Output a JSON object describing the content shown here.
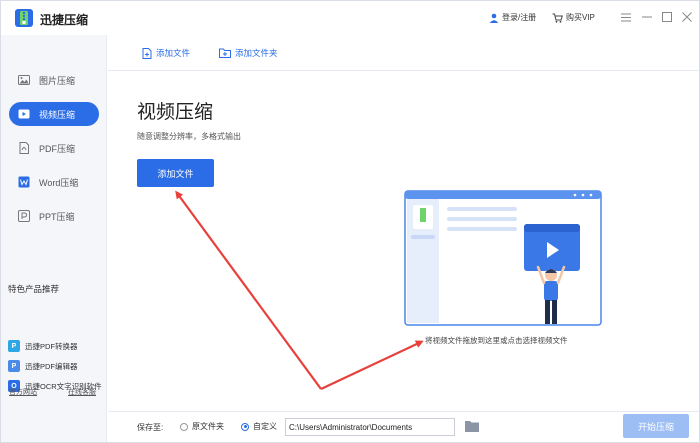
{
  "app": {
    "title": "迅捷压缩"
  },
  "header": {
    "login_label": "登录/注册",
    "vip_label": "购买VIP"
  },
  "sidebar": {
    "items": [
      {
        "label": "图片压缩",
        "icon": "image-icon"
      },
      {
        "label": "视频压缩",
        "icon": "video-icon",
        "active": true
      },
      {
        "label": "PDF压缩",
        "icon": "pdf-icon"
      },
      {
        "label": "Word压缩",
        "icon": "word-icon"
      },
      {
        "label": "PPT压缩",
        "icon": "ppt-icon"
      }
    ],
    "promo_title": "特色产品推荐",
    "promo_items": [
      {
        "label": "迅捷PDF转换器",
        "icon": "pdf-converter-icon"
      },
      {
        "label": "迅捷PDF编辑器",
        "icon": "pdf-editor-icon"
      },
      {
        "label": "迅捷OCR文字识别软件",
        "icon": "ocr-icon"
      }
    ],
    "footer_links": [
      "官方网站",
      "在线客服"
    ]
  },
  "toolbar": {
    "add_file": "添加文件",
    "add_folder": "添加文件夹"
  },
  "main": {
    "title": "视频压缩",
    "subtitle": "随意调整分辨率，多格式输出",
    "add_button": "添加文件",
    "drop_hint": "将视频文件拖放到这里或点击选择视频文件"
  },
  "footer": {
    "save_to_label": "保存至:",
    "option_original": "原文件夹",
    "option_custom": "自定义",
    "selected_option": "自定义",
    "path_value": "C:\\Users\\Administrator\\Documents",
    "start_button": "开始压缩"
  },
  "colors": {
    "accent": "#2b6de6",
    "start_disabled": "#9dbef4",
    "annotation_arrow": "#e8403a"
  }
}
